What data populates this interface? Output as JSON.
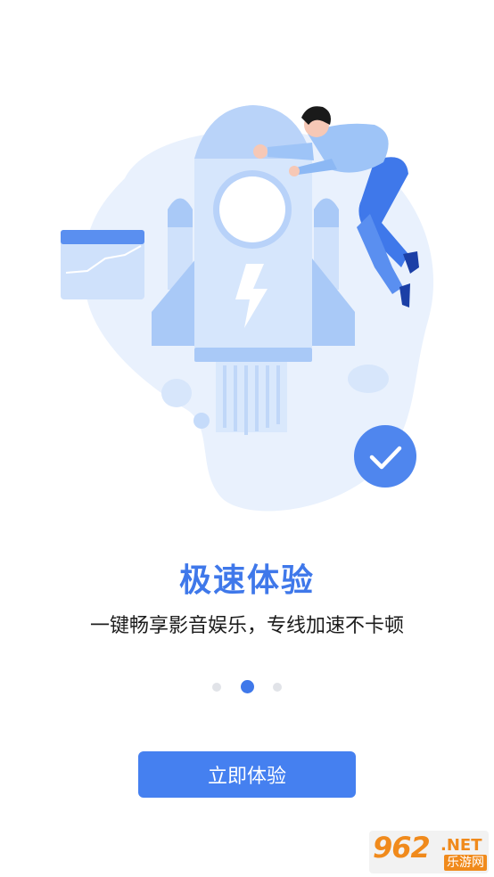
{
  "onboarding": {
    "title": "极速体验",
    "subtitle": "一键畅享影音娱乐，专线加速不卡顿",
    "page_indicator": {
      "total": 3,
      "current": 2
    },
    "cta_label": "立即体验"
  },
  "watermark": {
    "number": "962",
    "suffix": ".NET",
    "site_name": "乐游网"
  },
  "illustration": {
    "icons": [
      "rocket-icon",
      "lightning-icon",
      "checkmark-icon",
      "chart-card-icon",
      "person-icon"
    ],
    "colors": {
      "accent": "#3f78ea",
      "blob": "#e9f1fd",
      "rocket_light": "#d6e6fc",
      "rocket_mid": "#a9c9f7",
      "person_shirt": "#9ec4f7",
      "person_pants": "#3f78ea",
      "check_badge": "#4f86ee"
    }
  }
}
